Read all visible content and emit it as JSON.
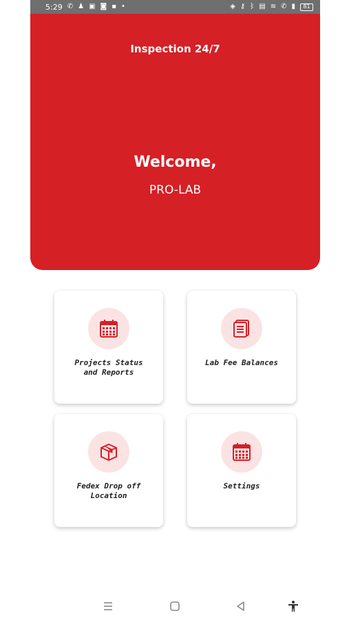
{
  "status_bar": {
    "time": "5:29",
    "left_icons": [
      "whatsapp-icon",
      "snapchat-icon",
      "app-icon",
      "instagram-icon",
      "lock-icon",
      "dot-icon"
    ],
    "right_icons": [
      "nfc-icon",
      "key-icon",
      "bluetooth-icon",
      "volte-icon",
      "wifi-icon",
      "call-icon",
      "signal-icon"
    ],
    "battery": "81"
  },
  "hero": {
    "title": "Inspection 24/7",
    "welcome": "Welcome,",
    "user": "PRO-LAB",
    "color": "#d52026"
  },
  "menu": {
    "items": [
      {
        "label_line1": "Projects Status",
        "label_line2": "and Reports",
        "icon": "calendar-icon"
      },
      {
        "label_line1": "Lab Fee Balances",
        "label_line2": "",
        "icon": "document-icon"
      },
      {
        "label_line1": "Fedex Drop off",
        "label_line2": "Location",
        "icon": "box-icon"
      },
      {
        "label_line1": "Settings",
        "label_line2": "",
        "icon": "calendar-icon"
      }
    ]
  },
  "nav_bar": {
    "buttons": [
      "recent-apps-icon",
      "home-icon",
      "back-icon",
      "accessibility-icon"
    ]
  }
}
